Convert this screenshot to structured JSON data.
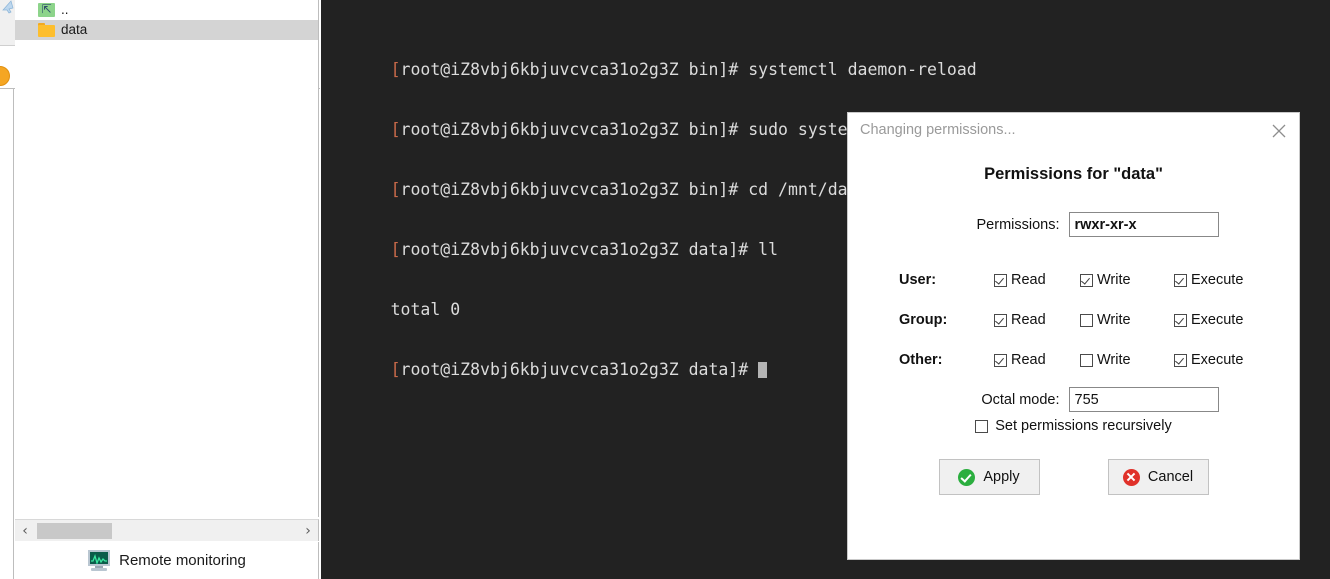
{
  "file_panel": {
    "rows": [
      {
        "label": "..",
        "icon": "updir-folder-icon",
        "selected": false
      },
      {
        "label": "data",
        "icon": "folder-icon",
        "selected": true
      }
    ],
    "scrollbar": {
      "left_arrow": "‹",
      "right_arrow": "›"
    },
    "status": {
      "icon": "remote-monitoring-icon",
      "label": "Remote monitoring"
    }
  },
  "terminal": {
    "background": "#222222",
    "foreground": "#dcdcdc",
    "bracket_color": "#c96a4a",
    "lines": [
      {
        "prompt": "[root@iZ8vbj6kbjuvcvca31o2g3Z bin]# ",
        "command": "systemctl daemon-reload"
      },
      {
        "prompt": "[root@iZ8vbj6kbjuvcvca31o2g3Z bin]# ",
        "command": "sudo systemctl start minio.service"
      },
      {
        "prompt": "[root@iZ8vbj6kbjuvcvca31o2g3Z bin]# ",
        "command": "cd /mnt/data"
      },
      {
        "prompt": "[root@iZ8vbj6kbjuvcvca31o2g3Z data]# ",
        "command": "ll"
      },
      {
        "prompt": "",
        "command": "total 0"
      },
      {
        "prompt": "[root@iZ8vbj6kbjuvcvca31o2g3Z data]# ",
        "command": "",
        "cursor": true
      }
    ]
  },
  "dialog": {
    "title": "Changing permissions...",
    "close_icon": "close-icon",
    "heading": "Permissions for \"data\"",
    "permissions": {
      "label": "Permissions:",
      "value": "rwxr-xr-x"
    },
    "octal": {
      "label": "Octal mode:",
      "value": "755"
    },
    "columns": [
      "Read",
      "Write",
      "Execute"
    ],
    "rows": [
      {
        "label": "User:",
        "read": true,
        "write": true,
        "execute": true
      },
      {
        "label": "Group:",
        "read": true,
        "write": false,
        "execute": true
      },
      {
        "label": "Other:",
        "read": true,
        "write": false,
        "execute": true
      }
    ],
    "recursive": {
      "label": "Set permissions recursively",
      "checked": false
    },
    "buttons": {
      "apply": {
        "label": "Apply",
        "icon": "green-check-icon",
        "color": "#2bae3f"
      },
      "cancel": {
        "label": "Cancel",
        "icon": "red-cross-icon",
        "color": "#e0312a"
      }
    }
  }
}
